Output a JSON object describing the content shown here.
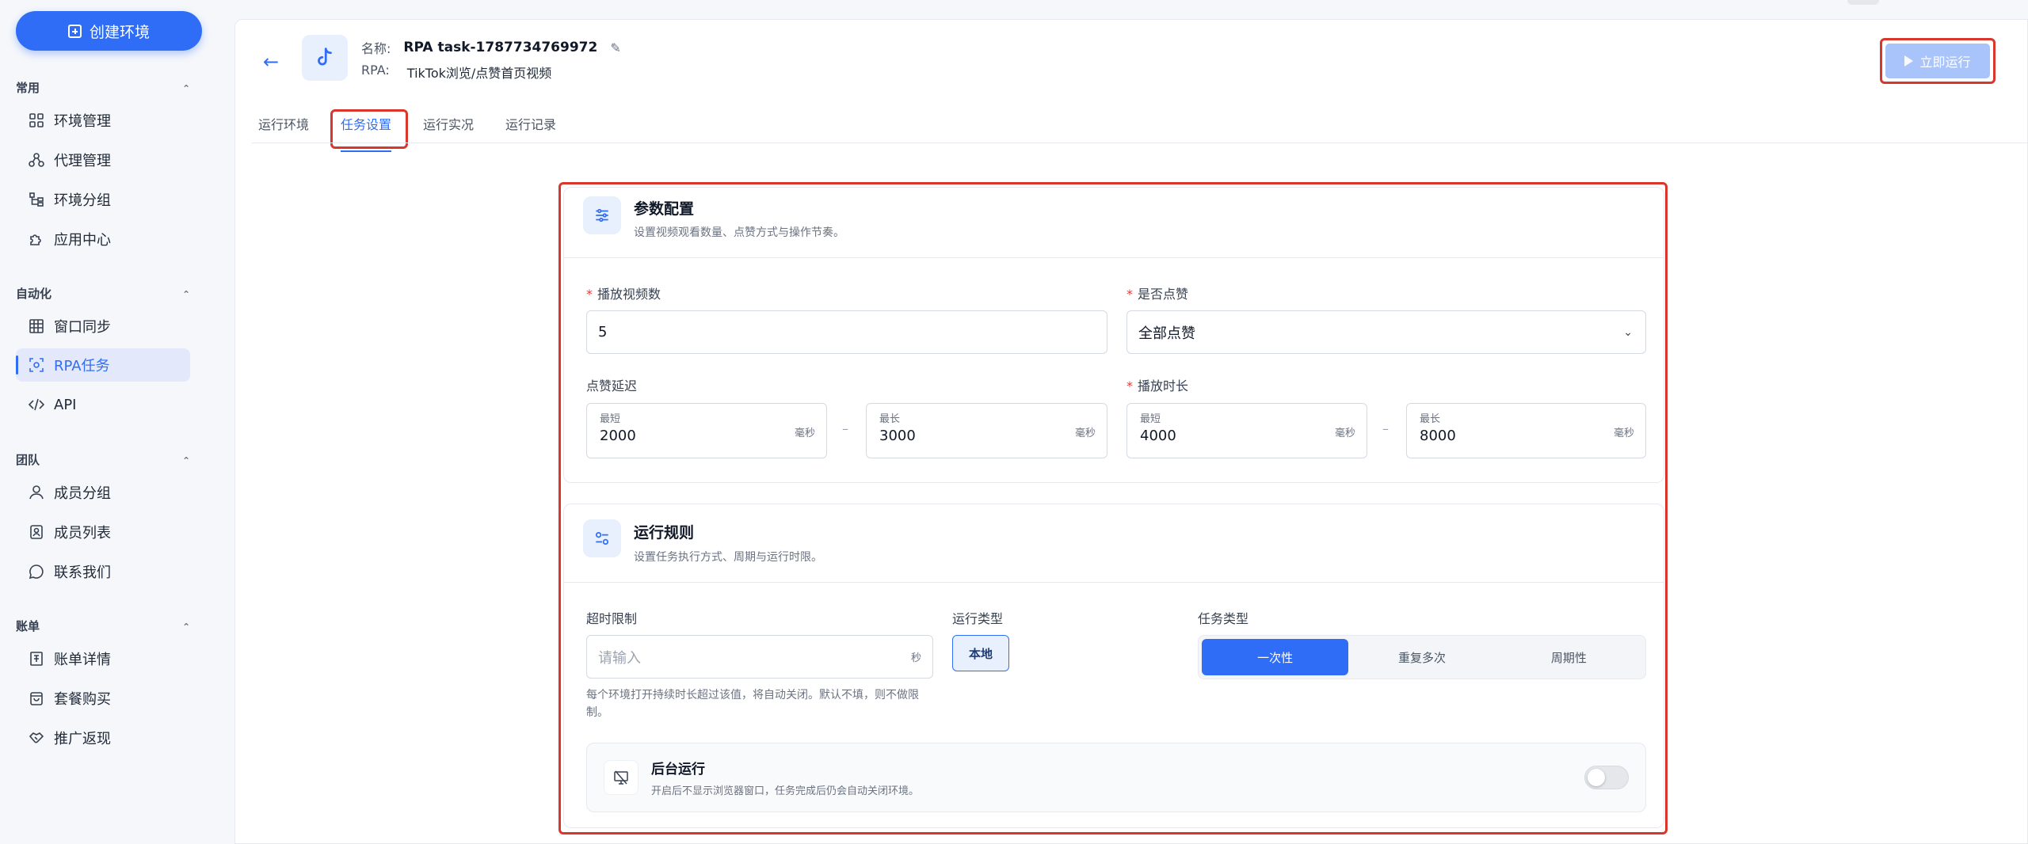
{
  "sidebar": {
    "create_label": "创建环境",
    "groups": [
      {
        "title": "常用",
        "items": [
          {
            "label": "环境管理",
            "icon": "grid-icon"
          },
          {
            "label": "代理管理",
            "icon": "network-icon"
          },
          {
            "label": "环境分组",
            "icon": "tree-icon"
          },
          {
            "label": "应用中心",
            "icon": "puzzle-icon"
          }
        ]
      },
      {
        "title": "自动化",
        "items": [
          {
            "label": "窗口同步",
            "icon": "table-icon"
          },
          {
            "label": "RPA任务",
            "icon": "scan-icon"
          },
          {
            "label": "API",
            "icon": "code-icon"
          }
        ]
      },
      {
        "title": "团队",
        "items": [
          {
            "label": "成员分组",
            "icon": "user-icon"
          },
          {
            "label": "成员列表",
            "icon": "contact-icon"
          },
          {
            "label": "联系我们",
            "icon": "chat-icon"
          }
        ]
      },
      {
        "title": "账单",
        "items": [
          {
            "label": "账单详情",
            "icon": "bill-icon"
          },
          {
            "label": "套餐购买",
            "icon": "bag-icon"
          },
          {
            "label": "推广返现",
            "icon": "handshake-icon"
          }
        ]
      }
    ]
  },
  "header": {
    "name_label": "名称:",
    "name_value": "RPA task-1787734769972",
    "rpa_label": "RPA:",
    "rpa_value": "TikTok浏览/点赞首页视频",
    "run_label": "立即运行"
  },
  "tabs": [
    "运行环境",
    "任务设置",
    "运行实况",
    "运行记录"
  ],
  "params": {
    "title": "参数配置",
    "subtitle": "设置视频观看数量、点赞方式与操作节奏。",
    "play_count_label": "播放视频数",
    "play_count_value": "5",
    "like_label": "是否点赞",
    "like_value": "全部点赞",
    "like_delay_label": "点赞延迟",
    "play_duration_label": "播放时长",
    "min_label": "最短",
    "max_label": "最长",
    "unit_ms": "毫秒",
    "range_sep": "–",
    "like_delay_min": "2000",
    "like_delay_max": "3000",
    "play_duration_min": "4000",
    "play_duration_max": "8000"
  },
  "rules": {
    "title": "运行规则",
    "subtitle": "设置任务执行方式、周期与运行时限。",
    "timeout_label": "超时限制",
    "timeout_placeholder": "请输入",
    "timeout_unit": "秒",
    "timeout_hint_1": "每个环境打开持续时长超过该值，将自动关闭。默认不填，则不做限",
    "timeout_hint_2": "制。",
    "run_type_label": "运行类型",
    "run_type_value": "本地",
    "task_type_label": "任务类型",
    "task_types": [
      "一次性",
      "重复多次",
      "周期性"
    ],
    "bg_title": "后台运行",
    "bg_desc": "开启后不显示浏览器窗口，任务完成后仍会自动关闭环境。",
    "bg_enabled": false
  },
  "colors": {
    "accent": "#2f6df6",
    "highlight": "#d9372b"
  }
}
